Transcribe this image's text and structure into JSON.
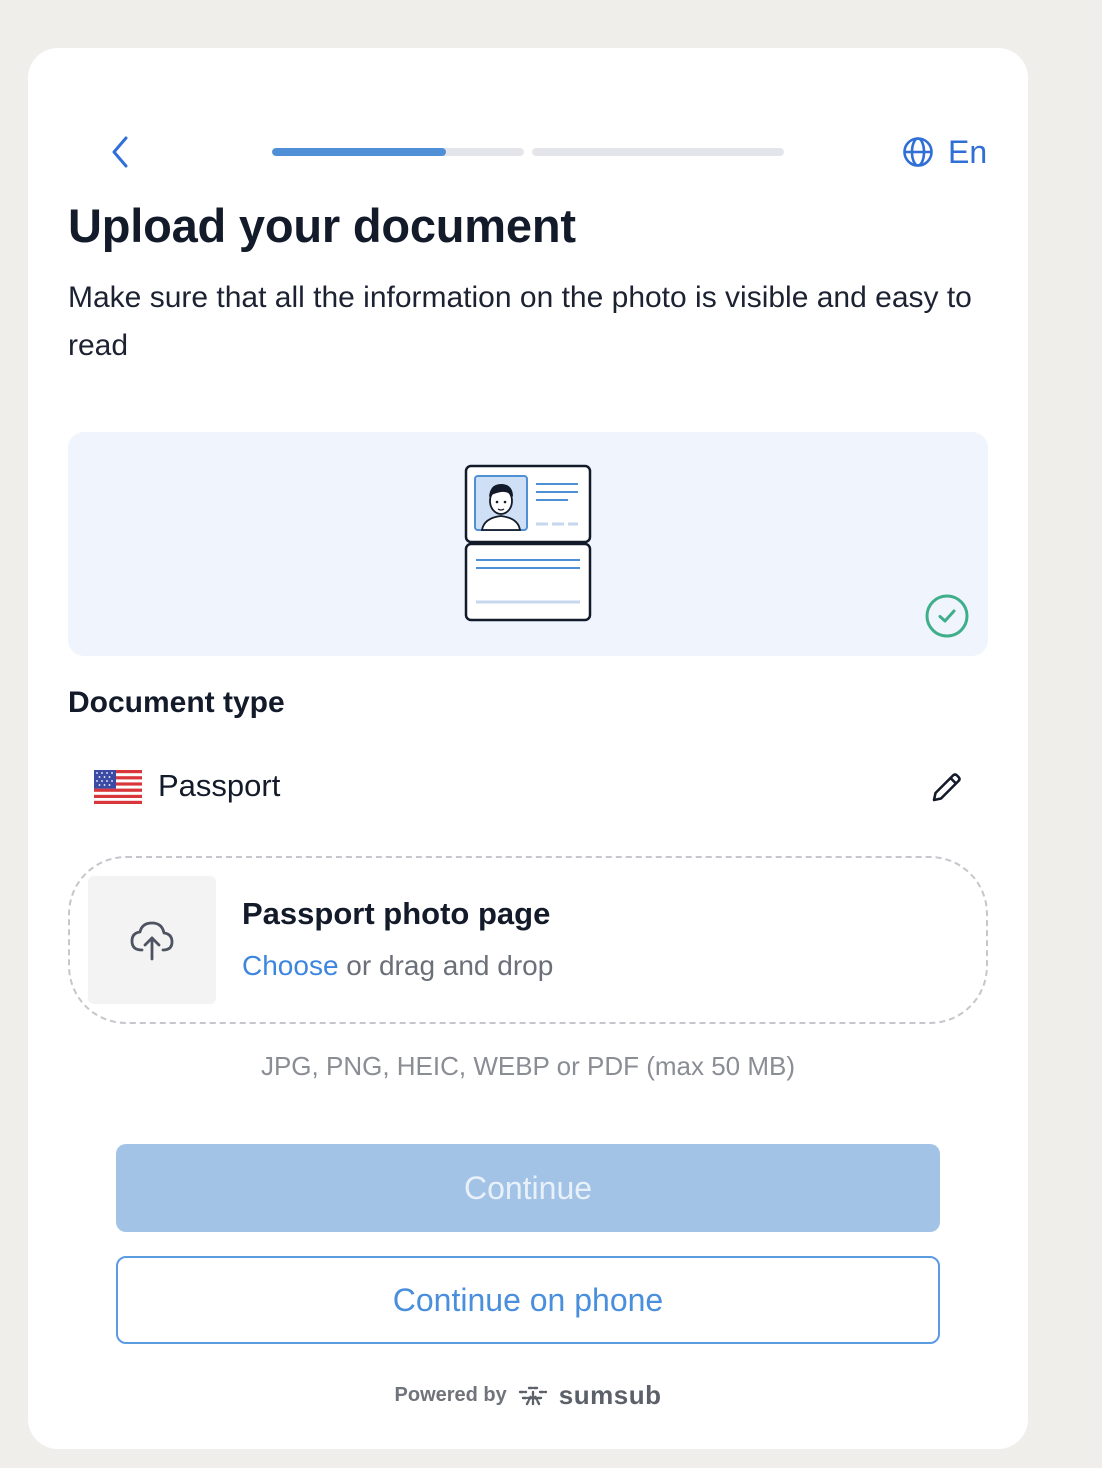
{
  "header": {
    "back_icon": "chevron-left-icon",
    "progress": [
      0.69,
      0.0
    ],
    "language_icon": "globe-icon",
    "language_label": "En"
  },
  "title": "Upload your document",
  "subtitle": "Make sure that all the information on the photo is visible and easy to read",
  "illustration": {
    "image": "passport-illustration",
    "status_icon": "check-circle-icon"
  },
  "document_type": {
    "label": "Document type",
    "country_flag_icon": "us-flag-icon",
    "name": "Passport",
    "edit_icon": "pencil-icon"
  },
  "upload": {
    "icon": "cloud-upload-icon",
    "title": "Passport photo page",
    "choose_label": "Choose",
    "drag_text": " or drag and drop",
    "formats": "JPG, PNG, HEIC, WEBP or PDF (max 50 MB)"
  },
  "buttons": {
    "continue_label": "Continue",
    "phone_label": "Continue on phone"
  },
  "footer": {
    "powered_by": "Powered by",
    "brand": "sumsub"
  },
  "colors": {
    "accent": "#2f6fd6",
    "progress_fill": "#4f8fd6",
    "disabled_button": "#a2c3e6",
    "success": "#3fae8a",
    "illustration_bg": "#f0f4fc"
  }
}
